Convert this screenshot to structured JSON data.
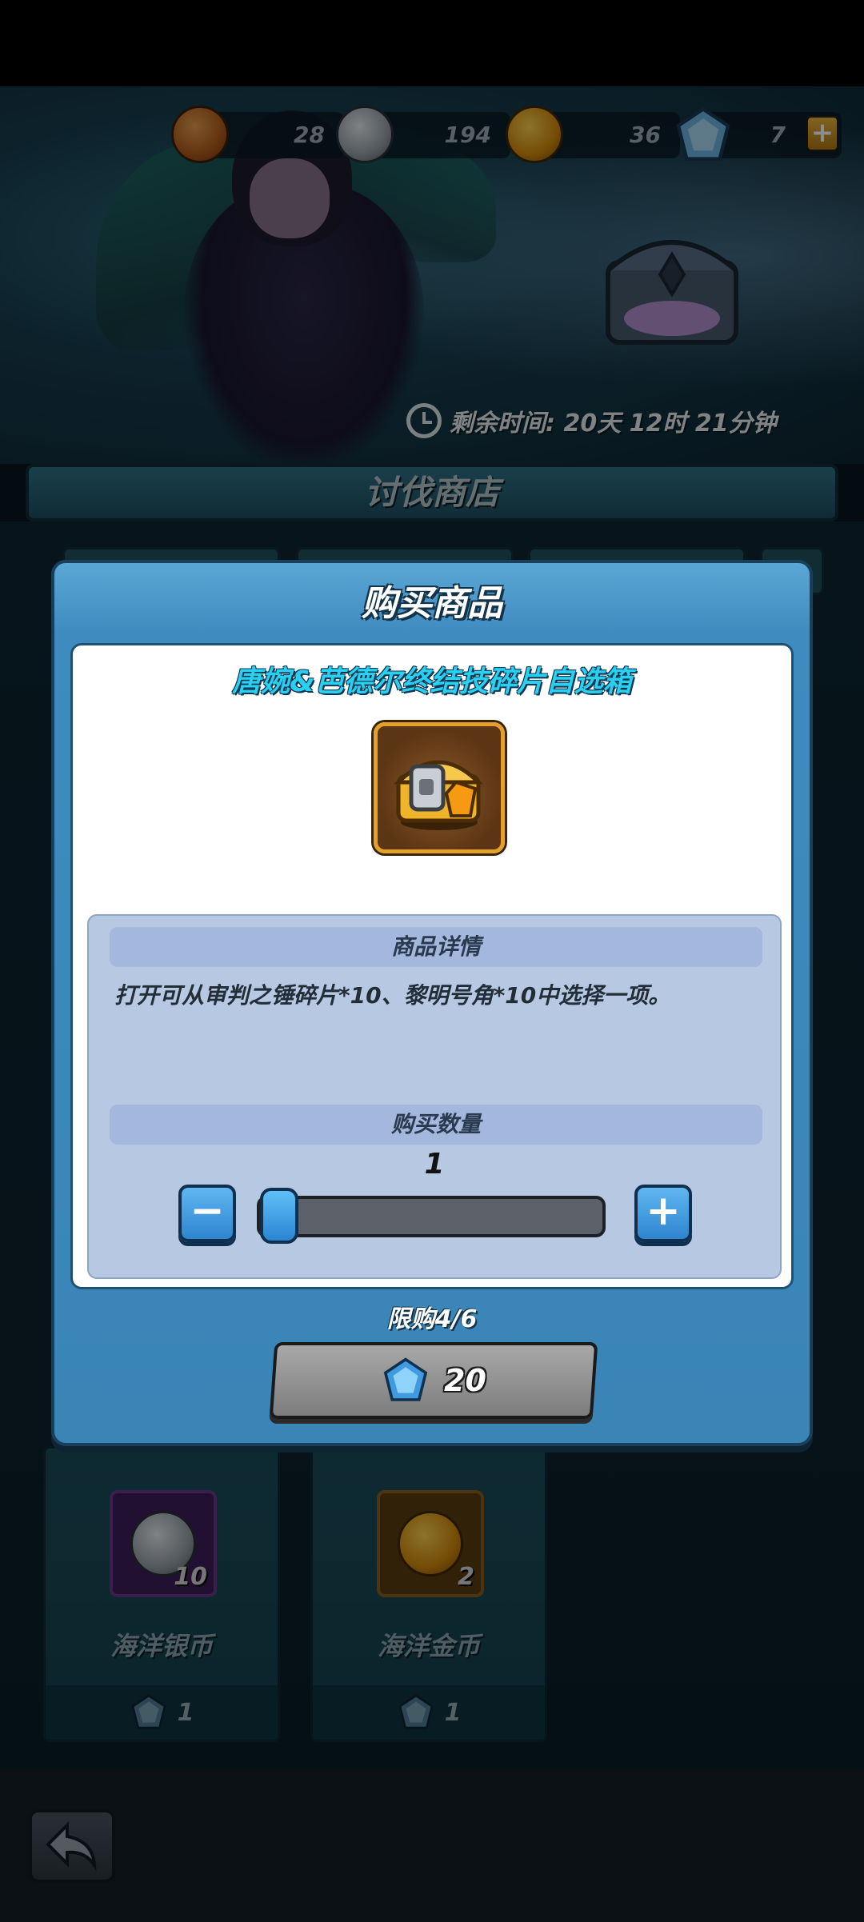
{
  "currency": {
    "bronze_coins": "28",
    "silver_coins": "194",
    "gold_coins": "36",
    "gems": "7",
    "add_label": "+"
  },
  "banner": {
    "remaining_time": "剩余时间: 20天 12时 21分钟"
  },
  "shop": {
    "title": "讨伐商店",
    "items": [
      {
        "name": "海洋银币",
        "quantity": "10",
        "price": "1",
        "icon": "ocean-silver-coin-icon"
      },
      {
        "name": "海洋金币",
        "quantity": "2",
        "price": "1",
        "icon": "ocean-gold-coin-icon"
      }
    ]
  },
  "modal": {
    "title": "购买商品",
    "item_name": "唐婉&芭德尔终结技碎片自选箱",
    "item_icon": "chest-icon",
    "details_header": "商品详情",
    "description": "打开可从审判之锤碎片*10、黎明号角*10中选择一项。",
    "quantity_header": "购买数量",
    "quantity": "1",
    "minus_label": "−",
    "plus_label": "+",
    "purchase_limit": "限购4/6",
    "price": "20",
    "slider": {
      "min": 1,
      "max": 2,
      "value": 1
    }
  },
  "colors": {
    "modal_blue": "#3a84b6",
    "item_name_cyan": "#2ad0f0",
    "detail_bg": "#b6c8e2"
  }
}
